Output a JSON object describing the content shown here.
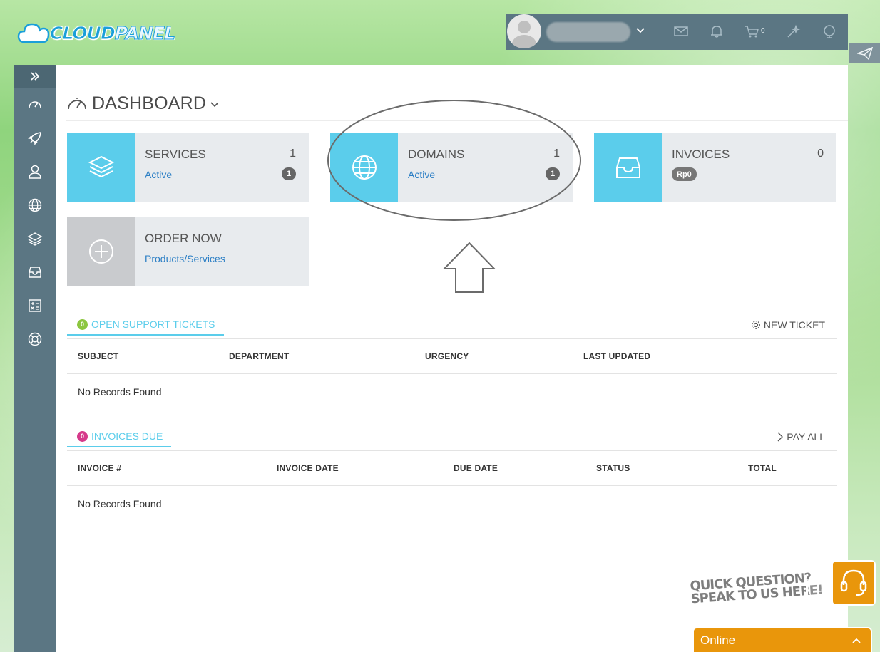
{
  "brand": {
    "logo_part1": "CLOUD",
    "logo_part2": "PANEL",
    "accent": "#5bcdeb",
    "sidebar_bg": "#5b7683"
  },
  "topbar": {
    "cart_count": "0",
    "icons": [
      "user-avatar",
      "chevron-down-icon",
      "envelope-icon",
      "bell-icon",
      "cart-icon",
      "magic-wand-icon",
      "globe-pin-icon"
    ]
  },
  "sidebar": {
    "items": [
      "dashboard-icon",
      "rocket-icon",
      "user-icon",
      "globe-icon",
      "layers-icon",
      "inbox-icon",
      "calculator-icon",
      "lifebuoy-icon"
    ]
  },
  "page": {
    "title": "DASHBOARD"
  },
  "tiles": {
    "services": {
      "label": "SERVICES",
      "count": "1",
      "sub": "Active",
      "badge": "1"
    },
    "domains": {
      "label": "DOMAINS",
      "count": "1",
      "sub": "Active",
      "badge": "1"
    },
    "invoices": {
      "label": "INVOICES",
      "count": "0",
      "badge": "Rp0"
    },
    "order": {
      "label": "ORDER NOW",
      "sub": "Products/Services"
    }
  },
  "tickets": {
    "count": "0",
    "tab_label": "OPEN SUPPORT TICKETS",
    "action": "NEW TICKET",
    "columns": [
      "SUBJECT",
      "DEPARTMENT",
      "URGENCY",
      "LAST UPDATED"
    ],
    "empty": "No Records Found"
  },
  "invoices_due": {
    "count": "0",
    "tab_label": "INVOICES DUE",
    "action": "PAY ALL",
    "columns": [
      "INVOICE #",
      "INVOICE DATE",
      "DUE DATE",
      "STATUS",
      "TOTAL"
    ],
    "empty": "No Records Found"
  },
  "chat": {
    "line1": "QUICK QUESTION?",
    "line2": "SPEAK TO US HERE!",
    "status": "Online"
  }
}
